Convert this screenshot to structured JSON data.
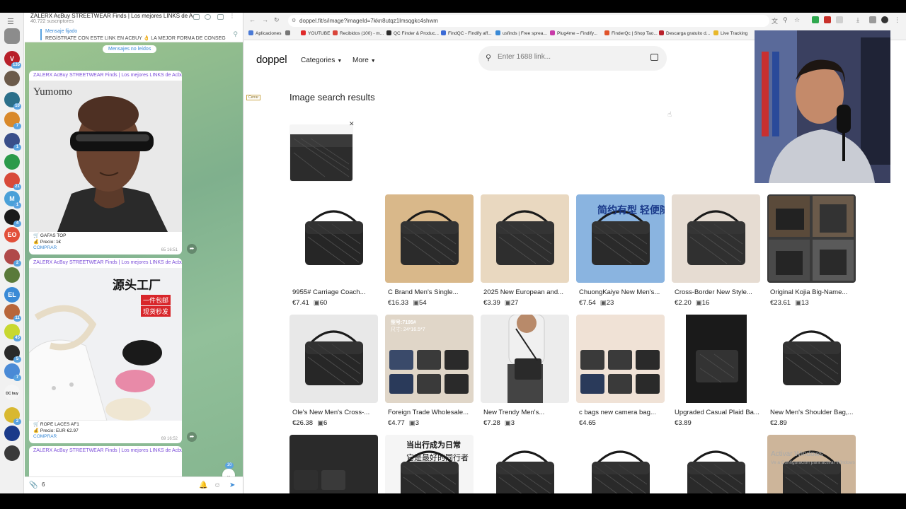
{
  "telegram": {
    "channel_title": "ZALERX AcBuy STREETWEAR Finds | Los mejores LINKS de Acbuy!",
    "subscribers": "40.722 suscriptores",
    "pinned_label": "Mensaje fijado",
    "pinned_text": "REGÍSTRATE CON ESTE LINK EN ACBUY 👌 LA MEJOR FORMA DE CONSEGUIR ENV...",
    "unread_label": "Mensajes no leídos",
    "post_header": "ZALERX AcBuy STREETWEAR Finds | Los mejores LINKS de Acbuy!",
    "post1": {
      "brand_text": "Yumomo",
      "title": "GAFAS TOP",
      "price": "Precio: 1€",
      "link": "COMPRAR",
      "meta": "65 16:51"
    },
    "post2": {
      "overlay_title": "源头工厂",
      "overlay_red1": "一件包邮",
      "overlay_red2": "现货秒发",
      "title": "ROPE LACES AF1",
      "price": "Precio: EUR €2.97",
      "link": "COMPRAR",
      "meta": "69 16:52"
    },
    "post3_header": "ZALERX AcBuy STREETWEAR Finds | Los mejores LINKS de Acbuy!",
    "scroll_badge": "10",
    "input_value": "6",
    "rail_items": [
      {
        "label": "",
        "color": "#8c8c8c",
        "badge": ""
      },
      {
        "label": "V",
        "color": "#b8202a",
        "badge": "135"
      },
      {
        "label": "",
        "color": "#6b5a4a",
        "badge": ""
      },
      {
        "label": "",
        "color": "#2b6f8a",
        "badge": "10"
      },
      {
        "label": "",
        "color": "#d9892b",
        "badge": "7"
      },
      {
        "label": "",
        "color": "#3a4f8a",
        "badge": "1"
      },
      {
        "label": "",
        "color": "#2b9a4a",
        "badge": ""
      },
      {
        "label": "",
        "color": "#d84a3a",
        "badge": "21"
      },
      {
        "label": "M",
        "color": "#4aa0d8",
        "badge": "1"
      },
      {
        "label": "",
        "color": "#1a1a1a",
        "badge": "4"
      },
      {
        "label": "EO",
        "color": "#e2503a",
        "badge": ""
      },
      {
        "label": "",
        "color": "#b04a4a",
        "badge": "2"
      },
      {
        "label": "",
        "color": "#5a7a3a",
        "badge": ""
      },
      {
        "label": "EL",
        "color": "#3a8ad6",
        "badge": ""
      },
      {
        "label": "",
        "color": "#b8663a",
        "badge": "11"
      },
      {
        "label": "",
        "color": "#c8d830",
        "badge": "45"
      },
      {
        "label": "",
        "color": "#2a2a2a",
        "badge": "5"
      },
      {
        "label": "",
        "color": "#4a8ad6",
        "badge": "7"
      },
      {
        "label": "DC buy",
        "color": "#f5f5f5",
        "badge": ""
      },
      {
        "label": "",
        "color": "#d8b830",
        "badge": "2"
      },
      {
        "label": "",
        "color": "#1a3a8a",
        "badge": ""
      },
      {
        "label": "",
        "color": "#3a3a3a",
        "badge": ""
      }
    ]
  },
  "browser": {
    "url": "doppel.fit/s/image?imageId=7kkn8utqz1lmsqgkc4shwm",
    "bookmarks": [
      "Aplicaciones",
      "YOUTUBE",
      "Recibidos (100) - m...",
      "QC Finder & Produc...",
      "FindQC - Findify aff...",
      "usfinds | Free sprea...",
      "Plug4me – Findify...",
      "FinderQc | Shop Tao...",
      "Descarga gratuito d...",
      "Live Tracking"
    ]
  },
  "site": {
    "logo": "doppel",
    "nav": [
      "Categories",
      "More"
    ],
    "search_placeholder": "Enter 1688 link...",
    "cerrar": "Cerrar",
    "section_title": "Image search results",
    "watermark": "Activar Windows",
    "watermark_sub": "Ve a Configuración para activar Windows"
  },
  "products": [
    {
      "name": "9955# Carriage Coach...",
      "price": "€7.41",
      "images": "60"
    },
    {
      "name": "C Brand Men's Single...",
      "price": "€16.33",
      "images": "54"
    },
    {
      "name": "2025 New European and...",
      "price": "€3.39",
      "images": "27"
    },
    {
      "name": "ChuongKaiye New Men's...",
      "price": "€7.54",
      "images": "23"
    },
    {
      "name": "Cross-Border New Style...",
      "price": "€2.20",
      "images": "16"
    },
    {
      "name": "Original Kojia Big-Name...",
      "price": "€23.61",
      "images": "13"
    },
    {
      "name": "Ole's New Men's Cross-...",
      "price": "€26.38",
      "images": "6"
    },
    {
      "name": "Foreign Trade Wholesale...",
      "price": "€4.77",
      "images": "3"
    },
    {
      "name": "New Trendy Men's...",
      "price": "€7.28",
      "images": "3"
    },
    {
      "name": "c bags new camera bag...",
      "price": "€4.65",
      "images": ""
    },
    {
      "name": "Upgraded Casual Plaid Ba...",
      "price": "€3.89",
      "images": ""
    },
    {
      "name": "New Men's Shoulder Bag,...",
      "price": "€2.89",
      "images": ""
    }
  ],
  "product_overlays": {
    "card4": "简约有型 轻便随行",
    "card8a": "型号:7195#",
    "card8b": "尺寸: 24*16.5*7",
    "card14a": "当出行成为日常",
    "card14b": "它是最好的同行者"
  }
}
